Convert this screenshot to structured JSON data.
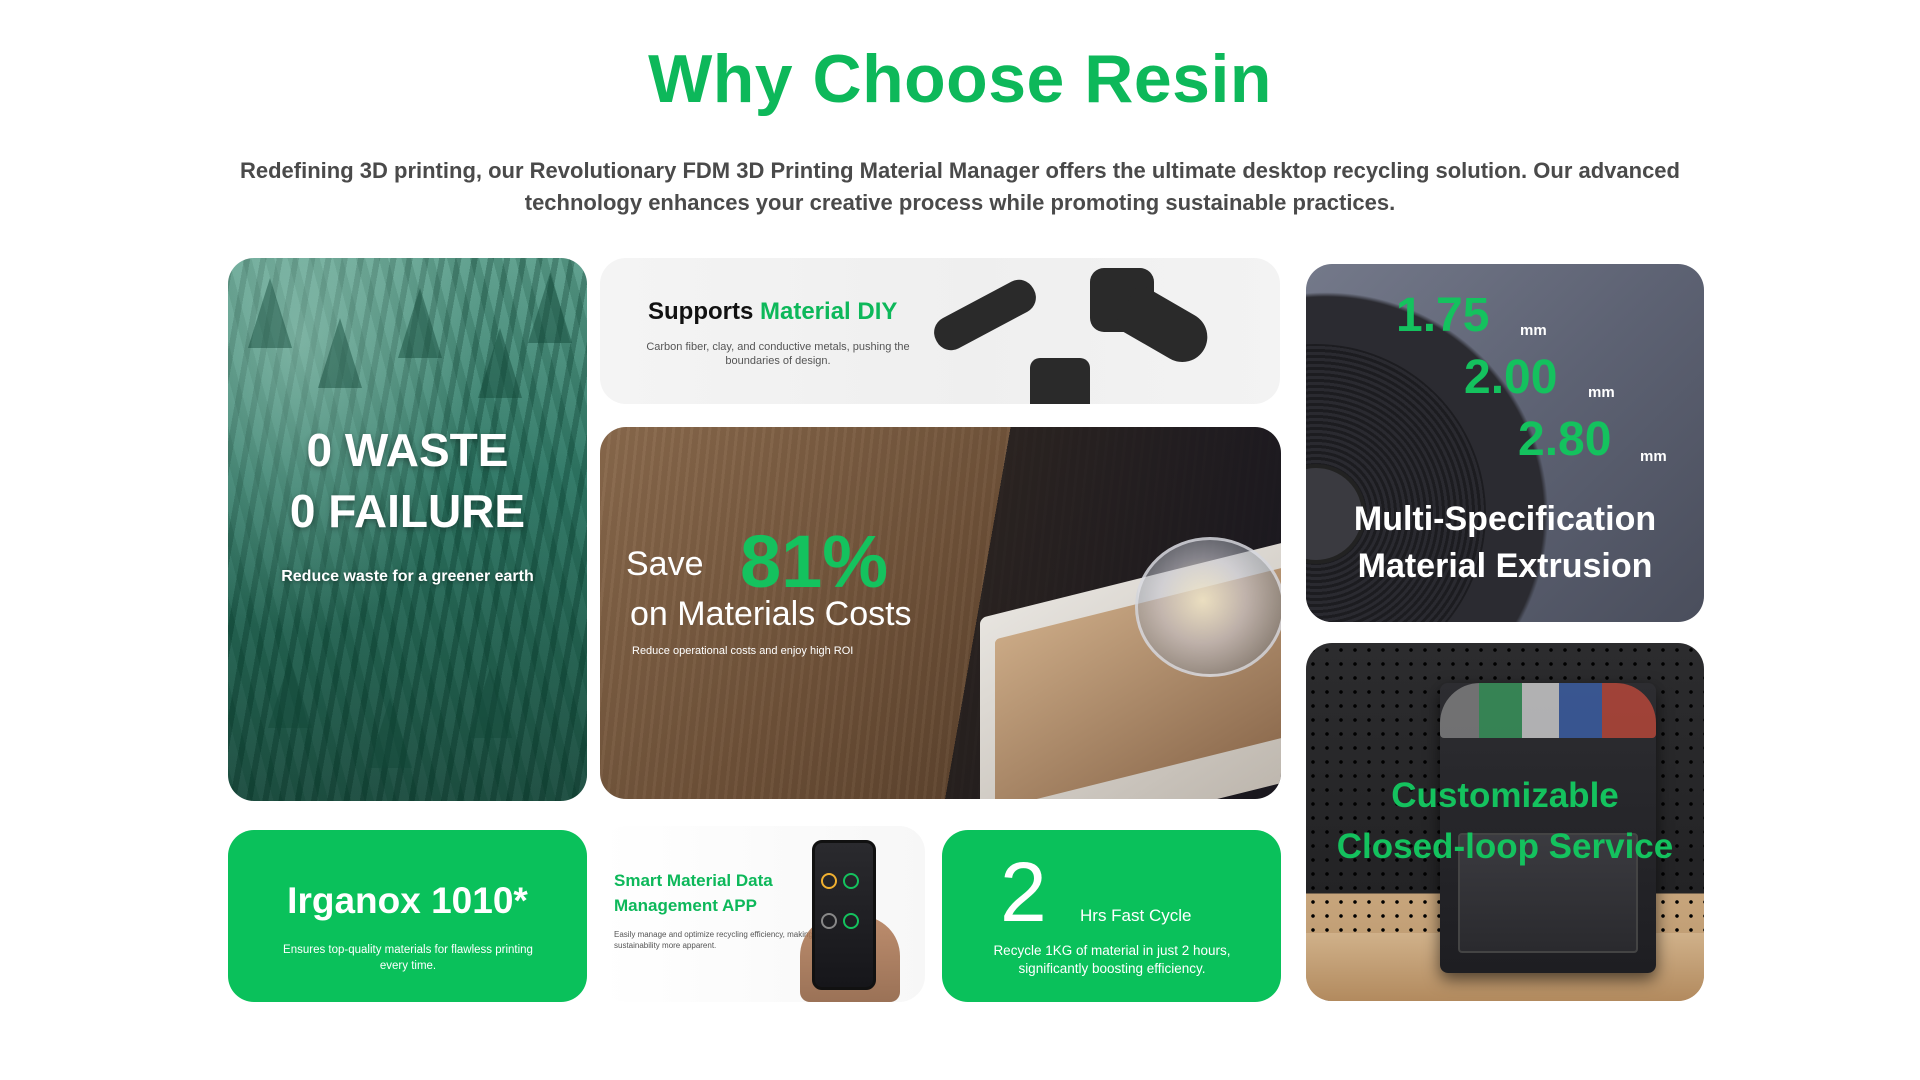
{
  "header": {
    "title": "Why Choose Resin",
    "subtitle": "Redefining 3D printing, our Revolutionary FDM 3D Printing Material Manager offers the ultimate desktop recycling solution. Our advanced technology enhances your creative process while promoting sustainable practices."
  },
  "forest": {
    "line1": "0 WASTE",
    "line2": "0 FAILURE",
    "sub": "Reduce waste for a greener earth"
  },
  "diy": {
    "title_prefix": "Supports",
    "title_highlight": "Material DIY",
    "desc": "Carbon fiber, clay, and conductive metals, pushing the boundaries of design."
  },
  "save": {
    "word": "Save",
    "percent": "81%",
    "line2": "on Materials Costs",
    "sub": "Reduce operational costs and enjoy high ROI"
  },
  "multi": {
    "specs": [
      {
        "value": "1.75",
        "unit": "mm"
      },
      {
        "value": "2.00",
        "unit": "mm"
      },
      {
        "value": "2.80",
        "unit": "mm"
      }
    ],
    "line1": "Multi-Specification",
    "line2": "Material Extrusion"
  },
  "printer": {
    "line1": "Customizable",
    "line2": "Closed-loop Service"
  },
  "irganox": {
    "title": "Irganox 1010*",
    "sub": "Ensures top-quality materials for flawless printing every time."
  },
  "app": {
    "line1": "Smart Material Data",
    "line2": "Management APP",
    "desc": "Easily manage and optimize recycling efficiency, making sustainability more apparent."
  },
  "cycle": {
    "number": "2",
    "label": "Hrs Fast Cycle",
    "sub": "Recycle 1KG of material in just 2 hours, significantly boosting efficiency."
  },
  "colors": {
    "brand_green": "#0db85a",
    "card_green": "#0ac15b"
  }
}
